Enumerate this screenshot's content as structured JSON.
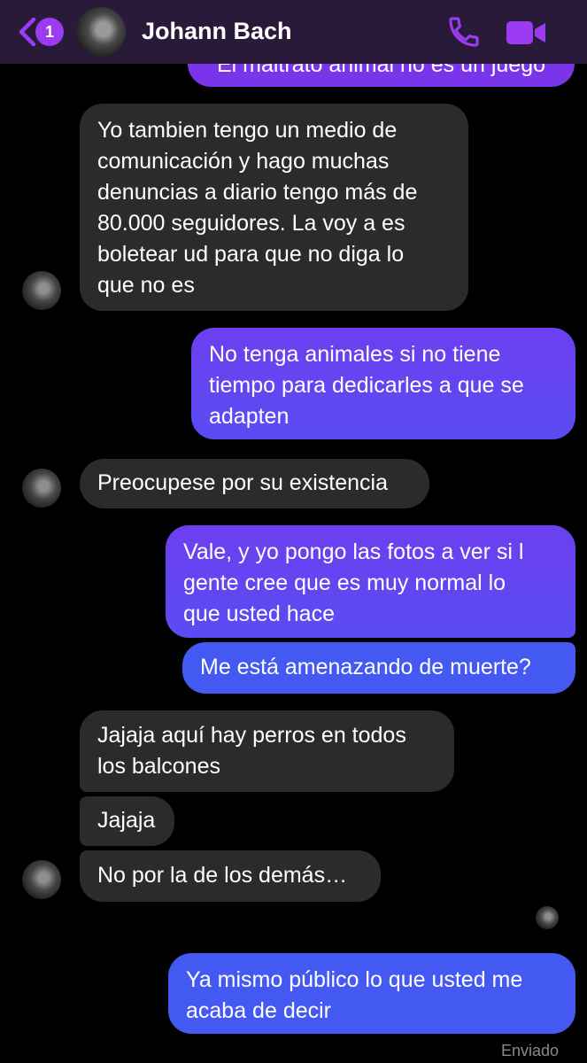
{
  "header": {
    "unread_badge": "1",
    "contact_name": "Johann Bach",
    "accent_color": "#9b3cf2",
    "icons": [
      "back-icon",
      "phone-icon",
      "video-camera-icon"
    ]
  },
  "messages": [
    {
      "direction": "outgoing",
      "lines": [
        "El maltrato animal no es un juego"
      ]
    },
    {
      "direction": "incoming",
      "lines": [
        "Yo tambien tengo un medio de",
        "comunicación y hago muchas",
        "denuncias a diario tengo más de",
        "80.000 seguidores. La voy a es",
        "boletear ud para que no diga lo",
        "que no es"
      ]
    },
    {
      "direction": "outgoing",
      "lines": [
        "No tenga animales si no tiene",
        "tiempo para dedicarles a que se",
        "adapten"
      ]
    },
    {
      "direction": "incoming",
      "lines": [
        "Preocupese por su existencia"
      ]
    },
    {
      "direction": "outgoing",
      "lines": [
        "Vale, y yo pongo las fotos a ver si l",
        "gente cree que es muy normal lo",
        "que usted hace"
      ]
    },
    {
      "direction": "outgoing",
      "lines": [
        "Me está amenazando de muerte?"
      ]
    },
    {
      "direction": "incoming",
      "lines": [
        "Jajaja aquí hay perros en todos",
        "los balcones"
      ]
    },
    {
      "direction": "incoming",
      "lines": [
        "Jajaja"
      ]
    },
    {
      "direction": "incoming",
      "lines": [
        "No por la de los demás…"
      ]
    },
    {
      "direction": "outgoing",
      "lines": [
        "Ya mismo público lo que usted me",
        "acaba de decir"
      ]
    }
  ],
  "status": "Enviado"
}
